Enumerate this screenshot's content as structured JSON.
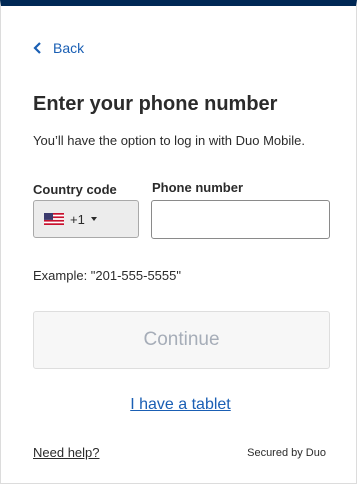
{
  "nav": {
    "back_label": "Back"
  },
  "header": {
    "title": "Enter your phone number",
    "subtitle": "You’ll have the option to log in with Duo Mobile."
  },
  "form": {
    "country_label": "Country code",
    "country_selected": "+1",
    "country_flag_icon": "us-flag-icon",
    "phone_label": "Phone number",
    "phone_value": "",
    "example_text": "Example: \"201-555-5555\""
  },
  "actions": {
    "continue_label": "Continue",
    "tablet_link": "I have a tablet"
  },
  "footer": {
    "help_link": "Need help?",
    "secured_text": "Secured by Duo"
  },
  "colors": {
    "top_bar": "#002855",
    "link": "#1a5fb4",
    "disabled_text": "#a6adb8"
  }
}
